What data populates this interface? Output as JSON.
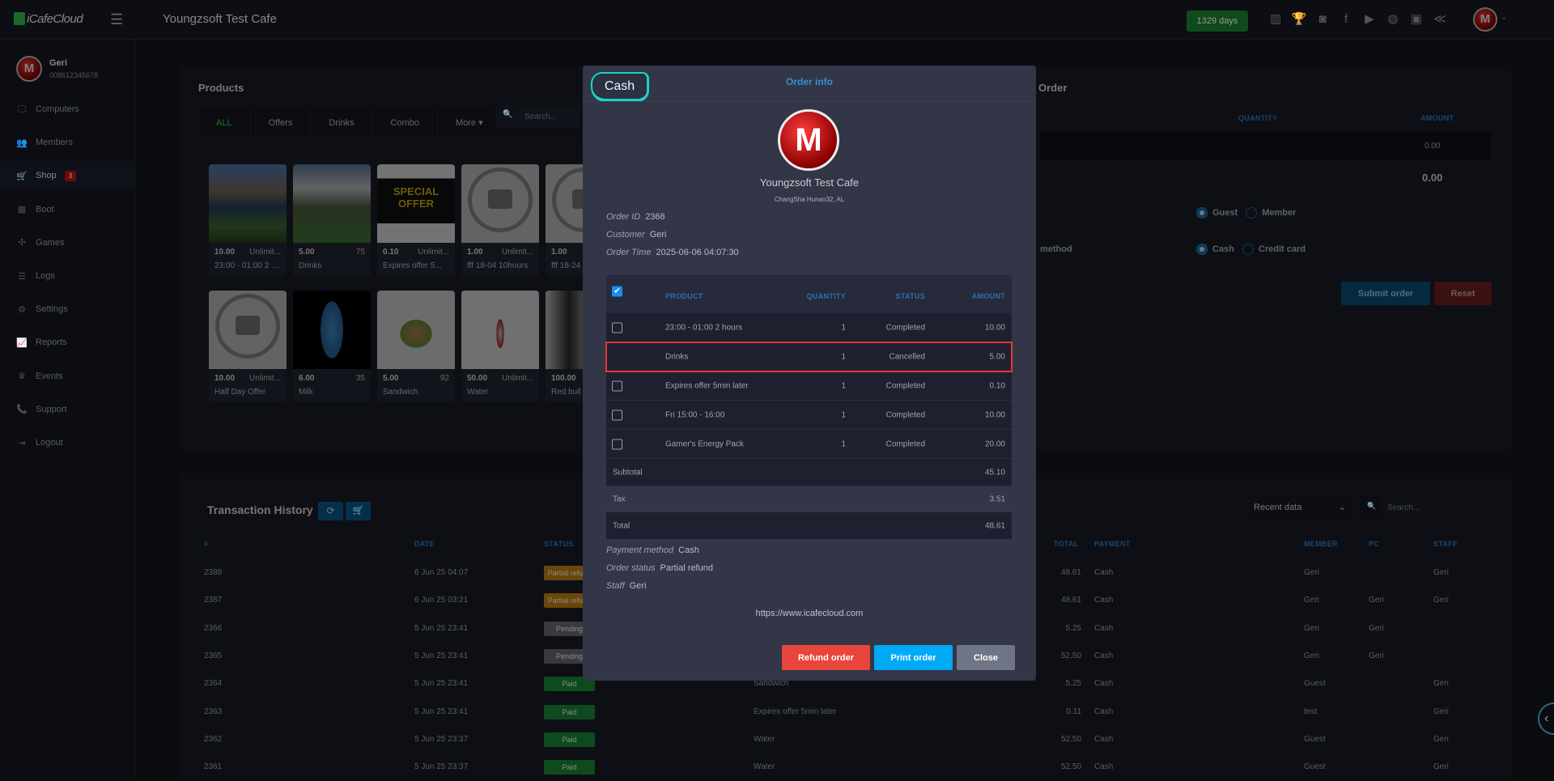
{
  "header": {
    "logo": "iCafeCloud",
    "cafe_name": "Youngzsoft Test Cafe",
    "days_label": "1329 days",
    "icons": [
      "leaderboard-icon",
      "trophy-icon",
      "discord-icon",
      "facebook-icon",
      "youtube-icon",
      "globe-icon",
      "icafe-icon",
      "brand-icon"
    ]
  },
  "profile": {
    "name": "Geri",
    "phone": "008612345678"
  },
  "sidebar": {
    "items": [
      {
        "label": "Computers",
        "icon": "🖵"
      },
      {
        "label": "Members",
        "icon": "👥"
      },
      {
        "label": "Shop",
        "icon": "🛒",
        "badge": "3"
      },
      {
        "label": "Boot",
        "icon": "▦"
      },
      {
        "label": "Games",
        "icon": "✣"
      },
      {
        "label": "Logs",
        "icon": "☰"
      },
      {
        "label": "Settings",
        "icon": "⚙"
      },
      {
        "label": "Reports",
        "icon": "📈"
      },
      {
        "label": "Events",
        "icon": "♛"
      },
      {
        "label": "Support",
        "icon": "📞"
      },
      {
        "label": "Logout",
        "icon": "⇥"
      }
    ]
  },
  "products": {
    "title": "Products",
    "tabs": [
      "ALL",
      "Offers",
      "Drinks",
      "Combo",
      "More ▾"
    ],
    "search_placeholder": "Search...",
    "cards": [
      {
        "price": "10.00",
        "stock": "Unlimit...",
        "name": "23:00 - 01:00 2 h...",
        "img": "lake"
      },
      {
        "price": "5.00",
        "stock": "75",
        "name": "Drinks",
        "img": "valley"
      },
      {
        "price": "0.10",
        "stock": "Unlimit...",
        "name": "Expires offer 5...",
        "img": "offer"
      },
      {
        "price": "1.00",
        "stock": "Unlimit...",
        "name": "fff 18-04 10hours",
        "img": "camera"
      },
      {
        "price": "1.00",
        "stock": "",
        "name": "fff 18-24",
        "img": "camera"
      },
      {
        "price": "10.00",
        "stock": "Unlimit...",
        "name": "Half Day Offer",
        "img": "camera"
      },
      {
        "price": "6.00",
        "stock": "35",
        "name": "Milk",
        "img": "milk"
      },
      {
        "price": "5.00",
        "stock": "92",
        "name": "Sandwich",
        "img": "sandwich"
      },
      {
        "price": "50.00",
        "stock": "Unlimit...",
        "name": "Water",
        "img": "water"
      },
      {
        "price": "100.00",
        "stock": "",
        "name": "Red bull",
        "img": "can"
      }
    ]
  },
  "order_panel": {
    "title": "Order",
    "col_quantity": "QUANTITY",
    "col_amount": "AMOUNT",
    "row_amount": "0.00",
    "total": "0.00",
    "customer_options": [
      "Guest",
      "Member"
    ],
    "payment_label": "method",
    "payment_options": [
      "Cash",
      "Credit card"
    ],
    "submit": "Submit order",
    "reset": "Reset"
  },
  "history": {
    "title": "Transaction History",
    "filter": "Recent data",
    "search_placeholder": "Search...",
    "columns": [
      "#",
      "DATE",
      "STATUS",
      "TOTAL",
      "PAYMENT",
      "MEMBER",
      "PC",
      "STAFF"
    ],
    "rows": [
      {
        "id": "2388",
        "date": "6 Jun 25 04:07",
        "status": "Partial refund",
        "product": "",
        "total": "48.61",
        "payment": "Cash",
        "member": "Geri",
        "pc": "",
        "staff": "Geri"
      },
      {
        "id": "2387",
        "date": "6 Jun 25 03:21",
        "status": "Partial refund",
        "product": "",
        "total": "48.61",
        "payment": "Cash",
        "member": "Geri",
        "pc": "Geri",
        "staff": "Geri"
      },
      {
        "id": "2366",
        "date": "5 Jun 25 23:41",
        "status": "Pending",
        "product": "",
        "total": "5.25",
        "payment": "Cash",
        "member": "Geri",
        "pc": "Geri",
        "staff": ""
      },
      {
        "id": "2365",
        "date": "5 Jun 25 23:41",
        "status": "Pending",
        "product": "",
        "total": "52.50",
        "payment": "Cash",
        "member": "Geri",
        "pc": "Geri",
        "staff": ""
      },
      {
        "id": "2364",
        "date": "5 Jun 25 23:41",
        "status": "Paid",
        "product": "Sandwich",
        "total": "5.25",
        "payment": "Cash",
        "member": "Guest",
        "pc": "",
        "staff": "Geri"
      },
      {
        "id": "2363",
        "date": "5 Jun 25 23:41",
        "status": "Paid",
        "product": "Expires offer 5min later",
        "total": "0.11",
        "payment": "Cash",
        "member": "test",
        "pc": "",
        "staff": "Geri"
      },
      {
        "id": "2362",
        "date": "5 Jun 25 23:37",
        "status": "Paid",
        "product": "Water",
        "total": "52.50",
        "payment": "Cash",
        "member": "Guest",
        "pc": "",
        "staff": "Geri"
      },
      {
        "id": "2361",
        "date": "5 Jun 25 23:37",
        "status": "Paid",
        "product": "Water",
        "total": "52.50",
        "payment": "Cash",
        "member": "Guest",
        "pc": "",
        "staff": "Geri"
      }
    ]
  },
  "modal": {
    "badge": "Cash",
    "title": "Order info",
    "cafe_name": "Youngzsoft Test Cafe",
    "address": "ChangSha Hunan32, AL",
    "order_id_label": "Order ID",
    "order_id": "2368",
    "customer_label": "Customer",
    "customer": "Geri",
    "order_time_label": "Order Time",
    "order_time": "2025-06-06 04:07:30",
    "columns": {
      "product": "PRODUCT",
      "quantity": "QUANTITY",
      "status": "STATUS",
      "amount": "AMOUNT"
    },
    "items": [
      {
        "product": "23:00 - 01:00 2 hours",
        "quantity": "1",
        "status": "Completed",
        "amount": "10.00",
        "checkbox": true,
        "highlighted": false
      },
      {
        "product": "Drinks",
        "quantity": "1",
        "status": "Cancelled",
        "amount": "5.00",
        "checkbox": false,
        "highlighted": true
      },
      {
        "product": "Expires offer 5min later",
        "quantity": "1",
        "status": "Completed",
        "amount": "0.10",
        "checkbox": true,
        "highlighted": false
      },
      {
        "product": "Fri 15:00 - 16:00",
        "quantity": "1",
        "status": "Completed",
        "amount": "10.00",
        "checkbox": true,
        "highlighted": false
      },
      {
        "product": "Gamer's Energy Pack",
        "quantity": "1",
        "status": "Completed",
        "amount": "20.00",
        "checkbox": true,
        "highlighted": false
      }
    ],
    "subtotal_label": "Subtotal",
    "subtotal": "45.10",
    "tax_label": "Tax",
    "tax": "3.51",
    "total_label": "Total",
    "total": "48.61",
    "payment_method_label": "Payment method",
    "payment_method": "Cash",
    "order_status_label": "Order status",
    "order_status": "Partial refund",
    "staff_label": "Staff",
    "staff": "Geri",
    "url": "https://www.icafecloud.com",
    "refund_button": "Refund order",
    "print_button": "Print order",
    "close_button": "Close"
  },
  "colors": {
    "accent_blue": "#3a8fd8",
    "refund": "#e8453c",
    "print": "#00aaf5",
    "close": "#6f7585",
    "highlight": "#e53935",
    "cash_badge": "#19d3c5"
  }
}
